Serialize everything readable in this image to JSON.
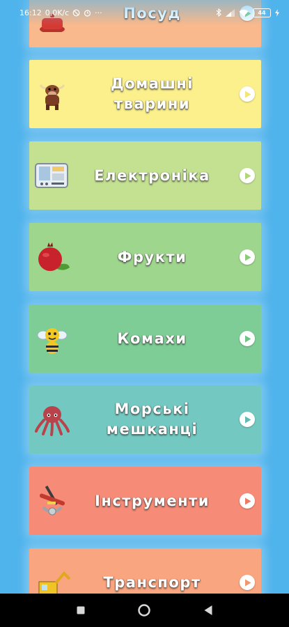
{
  "status_bar": {
    "time": "16:12",
    "speed": "0,0K/с",
    "more": "···",
    "battery": "44"
  },
  "categories": [
    {
      "label": "Посуд",
      "color": "#f9b98c",
      "thumb": "dish-icon"
    },
    {
      "label": "Домашні\nтварини",
      "color": "#fbf08c",
      "thumb": "bull-icon"
    },
    {
      "label": "Електроніка",
      "color": "#c3e191",
      "thumb": "electronics-icon"
    },
    {
      "label": "Фрукти",
      "color": "#9fd68d",
      "thumb": "pomegranate-icon"
    },
    {
      "label": "Комахи",
      "color": "#7fcd96",
      "thumb": "bee-icon"
    },
    {
      "label": "Морські\nмешканці",
      "color": "#73c9c1",
      "thumb": "octopus-icon"
    },
    {
      "label": "Інструменти",
      "color": "#f68c78",
      "thumb": "tools-icon"
    },
    {
      "label": "Транспорт",
      "color": "#f9a57f",
      "thumb": "excavator-icon"
    }
  ],
  "play_icon": "play-icon",
  "nav": {
    "recents": "square-icon",
    "home": "circle-icon",
    "back": "triangle-back-icon"
  }
}
